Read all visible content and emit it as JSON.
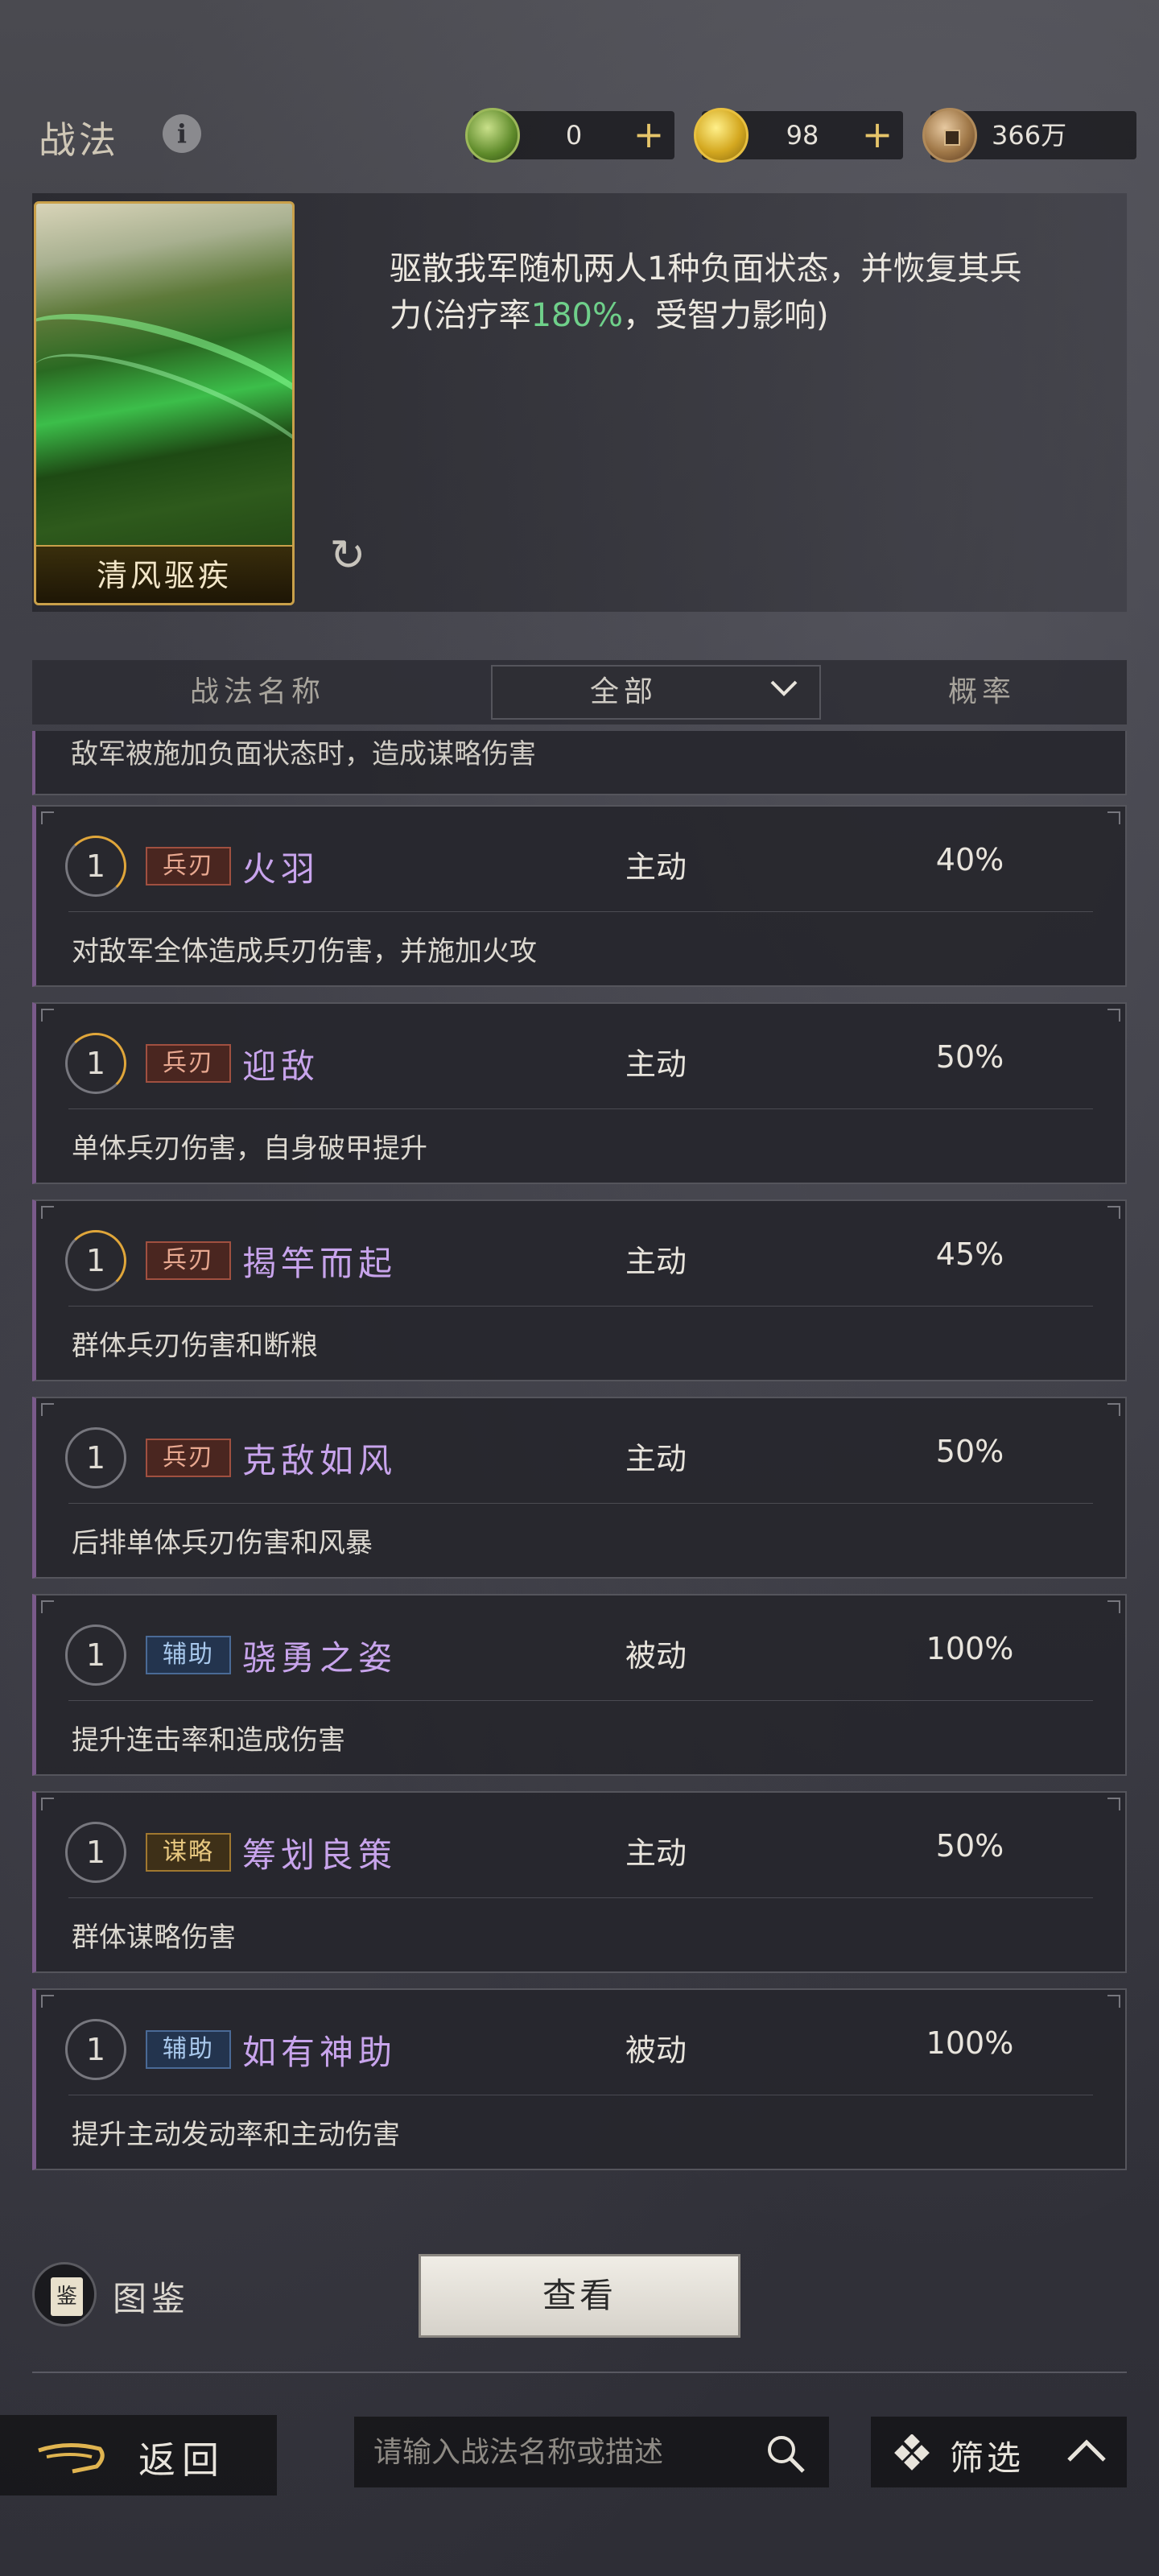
{
  "header": {
    "title": "战法",
    "resources": [
      {
        "icon": "jade-coin-icon",
        "value": "0",
        "has_plus": true
      },
      {
        "icon": "gold-coin-icon",
        "value": "98",
        "has_plus": true
      },
      {
        "icon": "copper-coin-icon",
        "value": "366万",
        "has_plus": false
      }
    ]
  },
  "detail": {
    "card_name": "清风驱疾",
    "desc_before": "驱散我军随机两人1种负面状态，并恢复其兵力(治疗率",
    "desc_highlight": "180%",
    "desc_after": "，受智力影响)",
    "highlight_color": "#6fd08a"
  },
  "table_header": {
    "col_name": "战法名称",
    "filter_value": "全部",
    "col_rate": "概率"
  },
  "partial_row_desc": "敌军被施加负面状态时，造成谋略伤害",
  "tactics": [
    {
      "level": "1",
      "arc": true,
      "tag": "兵刃",
      "tag_style": "red",
      "name": "火羽",
      "type": "主动",
      "rate": "40%",
      "desc": "对敌军全体造成兵刃伤害，并施加火攻"
    },
    {
      "level": "1",
      "arc": true,
      "tag": "兵刃",
      "tag_style": "red",
      "name": "迎敌",
      "type": "主动",
      "rate": "50%",
      "desc": "单体兵刃伤害，自身破甲提升"
    },
    {
      "level": "1",
      "arc": true,
      "tag": "兵刃",
      "tag_style": "red",
      "name": "揭竿而起",
      "type": "主动",
      "rate": "45%",
      "desc": "群体兵刃伤害和断粮"
    },
    {
      "level": "1",
      "arc": false,
      "tag": "兵刃",
      "tag_style": "red",
      "name": "克敌如风",
      "type": "主动",
      "rate": "50%",
      "desc": "后排单体兵刃伤害和风暴"
    },
    {
      "level": "1",
      "arc": false,
      "tag": "辅助",
      "tag_style": "blue",
      "name": "骁勇之姿",
      "type": "被动",
      "rate": "100%",
      "desc": "提升连击率和造成伤害"
    },
    {
      "level": "1",
      "arc": false,
      "tag": "谋略",
      "tag_style": "gold",
      "name": "筹划良策",
      "type": "主动",
      "rate": "50%",
      "desc": "群体谋略伤害"
    },
    {
      "level": "1",
      "arc": false,
      "tag": "辅助",
      "tag_style": "blue",
      "name": "如有神助",
      "type": "被动",
      "rate": "100%",
      "desc": "提升主动发动率和主动伤害"
    }
  ],
  "footer": {
    "codex_label": "图鉴",
    "codex_icon_char": "鉴",
    "view_button": "查看",
    "back_label": "返回",
    "search_placeholder": "请输入战法名称或描述",
    "filter_label": "筛选"
  }
}
